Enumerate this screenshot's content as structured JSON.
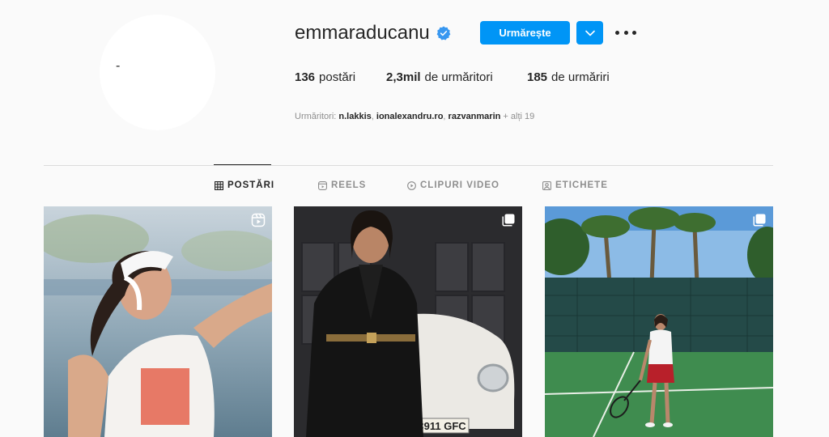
{
  "profile": {
    "username": "emmaraducanu",
    "avatar_alt": "-",
    "follow_label": "Urmărește",
    "stats": {
      "posts_count": "136",
      "posts_label": "postări",
      "followers_count": "2,3mil",
      "followers_label": "de urmăritori",
      "following_count": "185",
      "following_label": "de urmăriri"
    },
    "followed_by": {
      "prefix": "Urmăritori:",
      "names": [
        "n.lakkis",
        "ionalexandru.ro",
        "razvanmarin"
      ],
      "suffix": "+ alți 19"
    }
  },
  "tabs": [
    {
      "label": "POSTĂRI",
      "icon": "grid-icon",
      "active": true
    },
    {
      "label": "REELS",
      "icon": "reels-icon",
      "active": false
    },
    {
      "label": "CLIPURI VIDEO",
      "icon": "play-icon",
      "active": false
    },
    {
      "label": "ETICHETE",
      "icon": "tagged-icon",
      "active": false
    }
  ],
  "posts": [
    {
      "type": "reel",
      "badge_icon": "reel-badge-icon"
    },
    {
      "type": "carousel",
      "badge_icon": "carousel-badge-icon"
    },
    {
      "type": "carousel",
      "badge_icon": "carousel-badge-icon"
    }
  ],
  "colors": {
    "accent": "#0095f6",
    "verified": "#3897f0",
    "background": "#fafafa",
    "muted_text": "#8e8e8e"
  }
}
